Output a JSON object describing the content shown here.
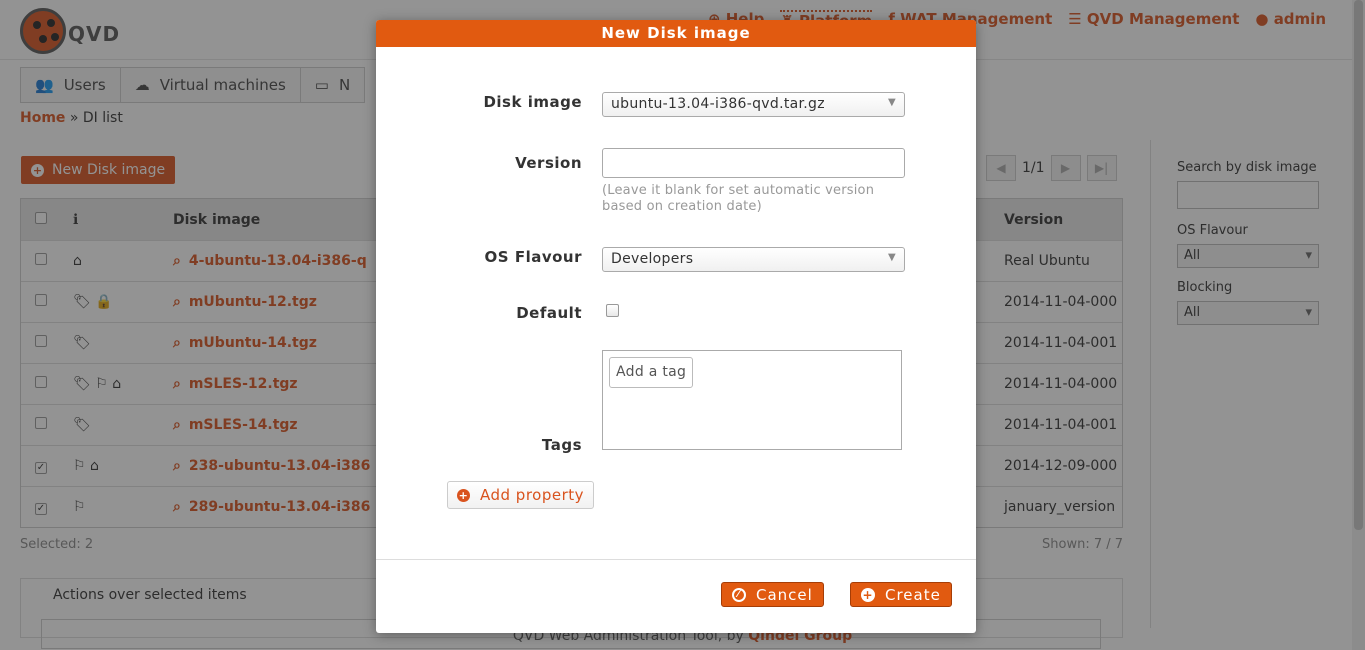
{
  "app": {
    "brand": "QVD",
    "topnav": {
      "help": "Help",
      "platform": "Platform",
      "wat_management": "WAT Management",
      "qvd_management": "QVD Management",
      "user": "admin"
    },
    "tabs": [
      {
        "label": "Users",
        "icon": "users-icon"
      },
      {
        "label": "Virtual machines",
        "icon": "cloud-icon"
      },
      {
        "label": "N",
        "icon": "server-icon"
      }
    ],
    "breadcrumb": {
      "home": "Home",
      "separator": "»",
      "current": "DI list"
    },
    "new_button": "New Disk image",
    "pager": {
      "label": "1/1"
    },
    "grid": {
      "headers": {
        "info": "ℹ",
        "name": "Disk image",
        "version": "Version"
      },
      "rows": [
        {
          "checked": false,
          "icons": "⌂",
          "name": "4-ubuntu-13.04-i386-q",
          "version": "Real Ubuntu"
        },
        {
          "checked": false,
          "icons": "🏷 🔒",
          "name": "mUbuntu-12.tgz",
          "version": "2014-11-04-000"
        },
        {
          "checked": false,
          "icons": "🏷",
          "name": "mUbuntu-14.tgz",
          "version": "2014-11-04-001"
        },
        {
          "checked": false,
          "icons": "🏷 ⚐ ⌂",
          "name": "mSLES-12.tgz",
          "version": "2014-11-04-000"
        },
        {
          "checked": false,
          "icons": "🏷",
          "name": "mSLES-14.tgz",
          "version": "2014-11-04-001"
        },
        {
          "checked": true,
          "icons": "⚐ ⌂",
          "name": "238-ubuntu-13.04-i386",
          "version": "2014-12-09-000"
        },
        {
          "checked": true,
          "icons": "⚐",
          "name": "289-ubuntu-13.04-i386",
          "version": "january_version"
        }
      ]
    },
    "selected_info": "Selected: 2",
    "shown_info": "Shown: 7 / 7",
    "sidebar": {
      "search_label": "Search by disk image",
      "os_flavour_label": "OS Flavour",
      "os_flavour_value": "All",
      "blocking_label": "Blocking",
      "blocking_value": "All"
    },
    "actions_legend": "Actions over selected items",
    "footer": {
      "text": "QVD Web Administration Tool, by",
      "org": "Qindel Group"
    }
  },
  "modal": {
    "title": "New Disk image",
    "disk_image": {
      "label": "Disk image",
      "value": "ubuntu-13.04-i386-qvd.tar.gz"
    },
    "version": {
      "label": "Version",
      "value": "",
      "hint": "(Leave it blank for set automatic version based on creation date)"
    },
    "os_flavour": {
      "label": "OS Flavour",
      "value": "Developers"
    },
    "default": {
      "label": "Default",
      "checked": false
    },
    "tags": {
      "label": "Tags",
      "placeholder": "Add a tag"
    },
    "add_property": "Add property",
    "cancel": "Cancel",
    "create": "Create"
  },
  "colors": {
    "accent": "#e15a10",
    "brand": "#d9531e",
    "overlay": "rgba(40,40,40,0.5)"
  }
}
